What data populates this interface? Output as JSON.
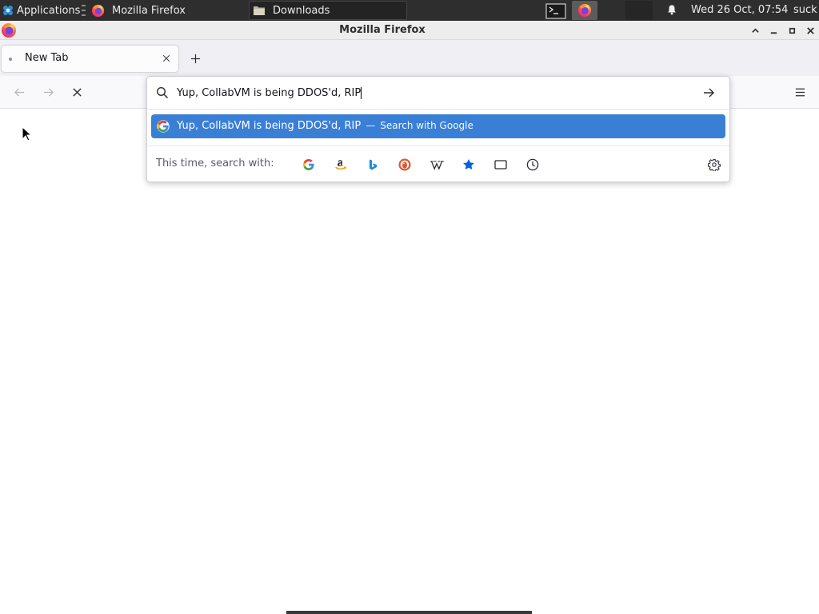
{
  "top_panel": {
    "applications": {
      "label": "Applications",
      "icon": "xfce-menu-icon"
    },
    "tasks": [
      {
        "label": "Mozilla Firefox",
        "icon": "firefox-icon"
      },
      {
        "label": "Downloads",
        "icon": "folder-icon",
        "highlighted": true
      }
    ],
    "launchers": [
      {
        "icon": "terminal-icon"
      },
      {
        "icon": "firefox-icon",
        "active": true
      }
    ],
    "notifications_icon": "bell-icon",
    "clock": "Wed 26 Oct, 07:54",
    "user": "suck"
  },
  "window": {
    "title": "Mozilla Firefox",
    "icon": "firefox-icon",
    "controls": [
      "shade-icon",
      "minimize-icon",
      "maximize-icon",
      "close-icon"
    ]
  },
  "tabs": [
    {
      "label": "New Tab",
      "loading": true,
      "close_icon": "close-icon"
    }
  ],
  "new_tab_icon": "plus-icon",
  "navigation": {
    "back_icon": "back-arrow-icon",
    "back_enabled": false,
    "forward_icon": "forward-arrow-icon",
    "forward_enabled": false,
    "stop_icon": "stop-icon",
    "menu_icon": "hamburger-menu-icon"
  },
  "url_bar": {
    "value": "Yup, CollabVM is being DDOS'd, RIP",
    "search_icon": "search-icon",
    "go_icon": "arrow-right-icon"
  },
  "suggestions": [
    {
      "text": "Yup, CollabVM is being DDOS'd, RIP",
      "separator": "—",
      "action": "Search with Google",
      "engine_icon": "google-icon",
      "selected": true
    }
  ],
  "search_with": {
    "label": "This time, search with:",
    "engines": [
      {
        "icon": "google-icon"
      },
      {
        "icon": "amazon-icon"
      },
      {
        "icon": "bing-icon"
      },
      {
        "icon": "duckduckgo-icon"
      },
      {
        "icon": "wikipedia-icon"
      },
      {
        "icon": "bookmarks-star-icon"
      },
      {
        "icon": "tabs-icon"
      },
      {
        "icon": "history-icon"
      }
    ],
    "settings_icon": "gear-icon"
  },
  "colors": {
    "panel_bg": "#2e2e2e",
    "accent": "#3a7fd6",
    "selected_text": "#ffffff",
    "star": "#0061e0"
  }
}
